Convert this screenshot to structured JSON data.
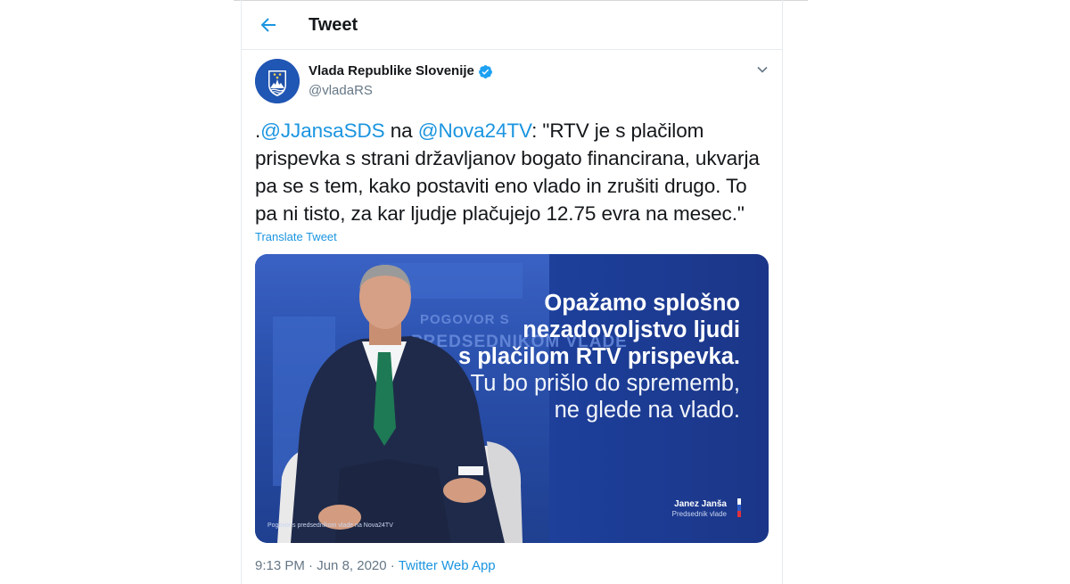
{
  "header": {
    "title": "Tweet"
  },
  "author": {
    "name": "Vlada Republike Slovenije",
    "handle": "@vladaRS"
  },
  "tweet": {
    "prefix": ".",
    "mention1": "@JJansaSDS",
    "between": " na ",
    "mention2": "@Nova24TV",
    "body": ": \"RTV je s plačilom prispevka s strani državljanov bogato financirana, ukvarja pa se s tem, kako postaviti eno vlado in zrušiti drugo. To pa ni tisto, za kar ljudje plačujejo 12.75 evra na mesec.\"",
    "translate_label": "Translate Tweet"
  },
  "media": {
    "quote_line1": "Opažamo splošno",
    "quote_line2": "nezadovoljstvo ljudi",
    "quote_line3": "s plačilom RTV prispevka.",
    "quote_line4": "Tu bo prišlo do sprememb,",
    "quote_line5": "ne glede na vlado.",
    "studio_text1": "POGOVOR S",
    "studio_text2": "PREDSEDNIKOM VLADE",
    "caption": "Pogovor s predsednikom vlade na Nova24TV",
    "signature_name": "Janez Janša",
    "signature_role": "Predsednik vlade"
  },
  "meta": {
    "time": "9:13 PM",
    "separator": " · ",
    "date": "Jun 8, 2020",
    "separator2": " · ",
    "source": "Twitter Web App"
  },
  "colors": {
    "link": "#1b95e0",
    "muted": "#657786",
    "media_blue": "#1d3f9a"
  }
}
